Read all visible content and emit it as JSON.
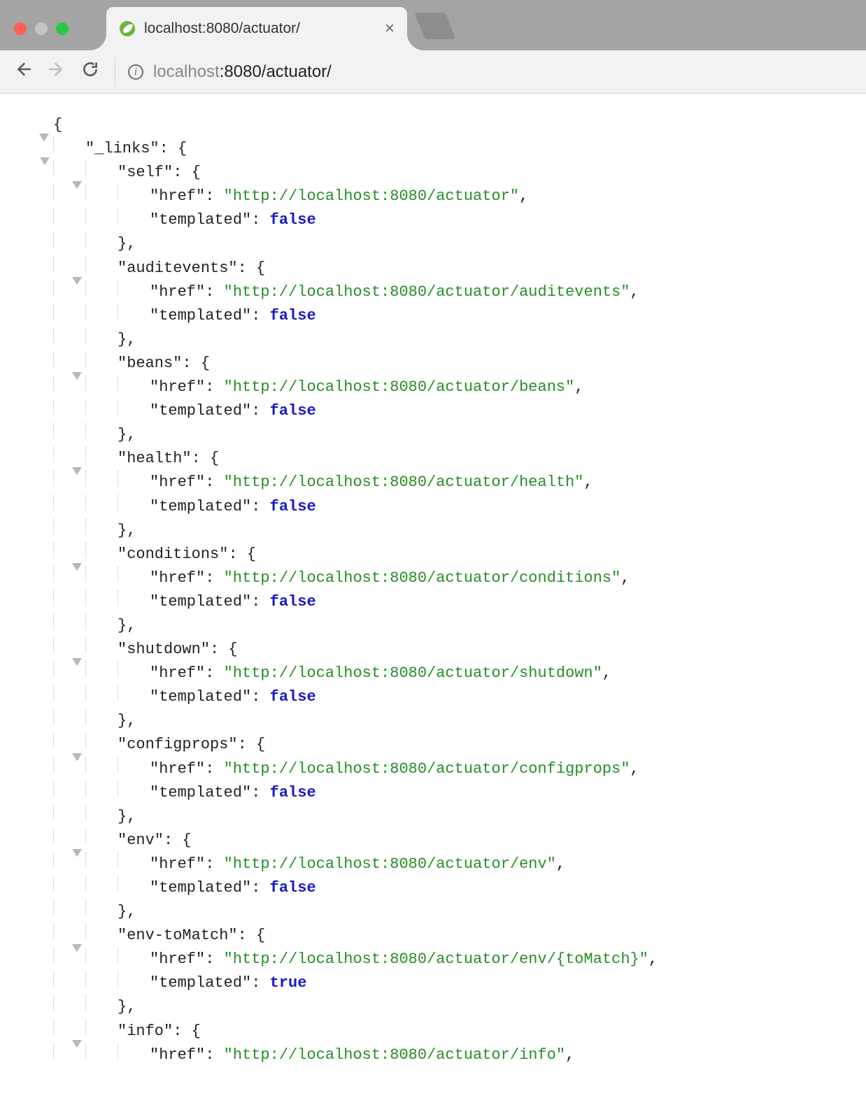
{
  "browser": {
    "tab_title": "localhost:8080/actuator/",
    "url_host_dim": "localhost",
    "url_rest": ":8080/actuator/",
    "close_glyph": "×"
  },
  "json_root_key": "_links",
  "links": [
    {
      "name": "self",
      "href": "http://localhost:8080/actuator",
      "templated": false
    },
    {
      "name": "auditevents",
      "href": "http://localhost:8080/actuator/auditevents",
      "templated": false
    },
    {
      "name": "beans",
      "href": "http://localhost:8080/actuator/beans",
      "templated": false
    },
    {
      "name": "health",
      "href": "http://localhost:8080/actuator/health",
      "templated": false
    },
    {
      "name": "conditions",
      "href": "http://localhost:8080/actuator/conditions",
      "templated": false
    },
    {
      "name": "shutdown",
      "href": "http://localhost:8080/actuator/shutdown",
      "templated": false
    },
    {
      "name": "configprops",
      "href": "http://localhost:8080/actuator/configprops",
      "templated": false
    },
    {
      "name": "env",
      "href": "http://localhost:8080/actuator/env",
      "templated": false
    },
    {
      "name": "env-toMatch",
      "href": "http://localhost:8080/actuator/env/{toMatch}",
      "templated": true
    },
    {
      "name": "info",
      "href": "http://localhost:8080/actuator/info",
      "templated": null,
      "partial": true
    }
  ],
  "prop_labels": {
    "href": "href",
    "templated": "templated"
  }
}
